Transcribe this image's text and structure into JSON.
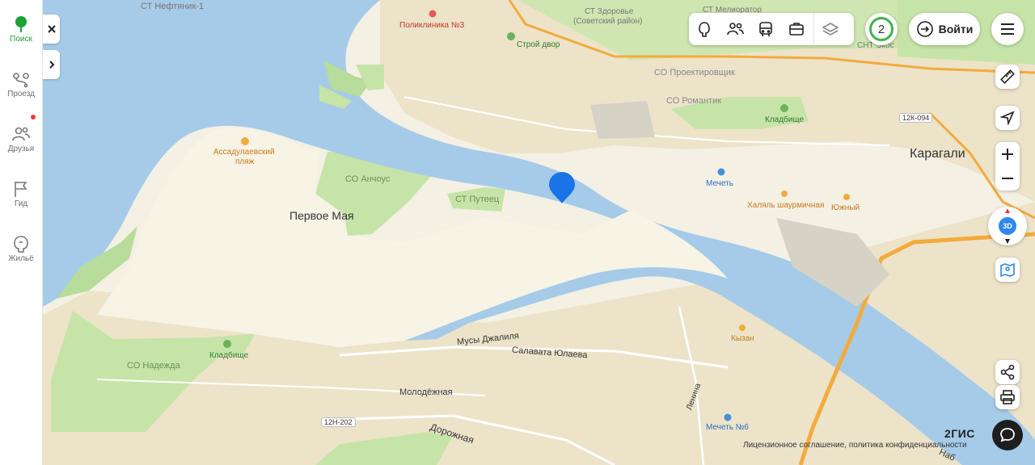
{
  "sidebar": {
    "items": [
      {
        "label": "Поиск",
        "icon": "search-tree-icon",
        "active": true
      },
      {
        "label": "Проезд",
        "icon": "route-icon"
      },
      {
        "label": "Друзья",
        "icon": "friends-icon",
        "notification": true
      },
      {
        "label": "Гид",
        "icon": "flag-icon"
      },
      {
        "label": "Жильё",
        "icon": "housing-icon"
      }
    ]
  },
  "header": {
    "notifications_count": "2",
    "login_label": "Войти"
  },
  "map_labels": {
    "st_neftyanik": "СТ Нефтяник-1",
    "poliklinika": "Поликлиника №3",
    "stroy_dvor": "Строй двор",
    "st_zdorovie_1": "СТ Здоровье",
    "st_zdorovie_2": "(Советский район)",
    "st_meliorator": "СТ Мелиоратор",
    "snt_ekos": "СНТ Экос",
    "so_proektirovshik": "СО Проектировщик",
    "so_romantik": "СО Романтик",
    "kladbishe_1": "Кладбище",
    "road_12k": "12К-094",
    "karagali": "Карагали",
    "assadulaev_1": "Ассадулаевский",
    "assadulaev_2": "пляж",
    "so_anchous": "СО Анчоус",
    "st_puteec": "СТ Путеец",
    "pervoe_maya": "Первое Мая",
    "mechet_1": "Мечеть",
    "halyal": "Халяль шаурмичная",
    "yuzhny": "Южный",
    "kyzan": "Кызан",
    "kladbishe_2": "Кладбище",
    "so_nadezhda": "СО Надежда",
    "musy": "Мусы Джалиля",
    "salavata": "Салавата Юлаева",
    "molodezhnaya": "Молодёжная",
    "lenina": "Ленина",
    "mechet_6": "Мечеть №6",
    "road_12n": "12Н-202",
    "dorozhnaya": "Дорожная",
    "nab": "Наб"
  },
  "footer": {
    "brand": "2ГИС",
    "license": "Лицензионное соглашение, политика конфиденциальности"
  },
  "colors": {
    "water": "#a5cbe9",
    "land": "#f4f0e4",
    "green": "#c6e4a7",
    "accent_green": "#1ba136",
    "marker_blue": "#1a74e8",
    "road_orange": "#f3ab3c"
  }
}
